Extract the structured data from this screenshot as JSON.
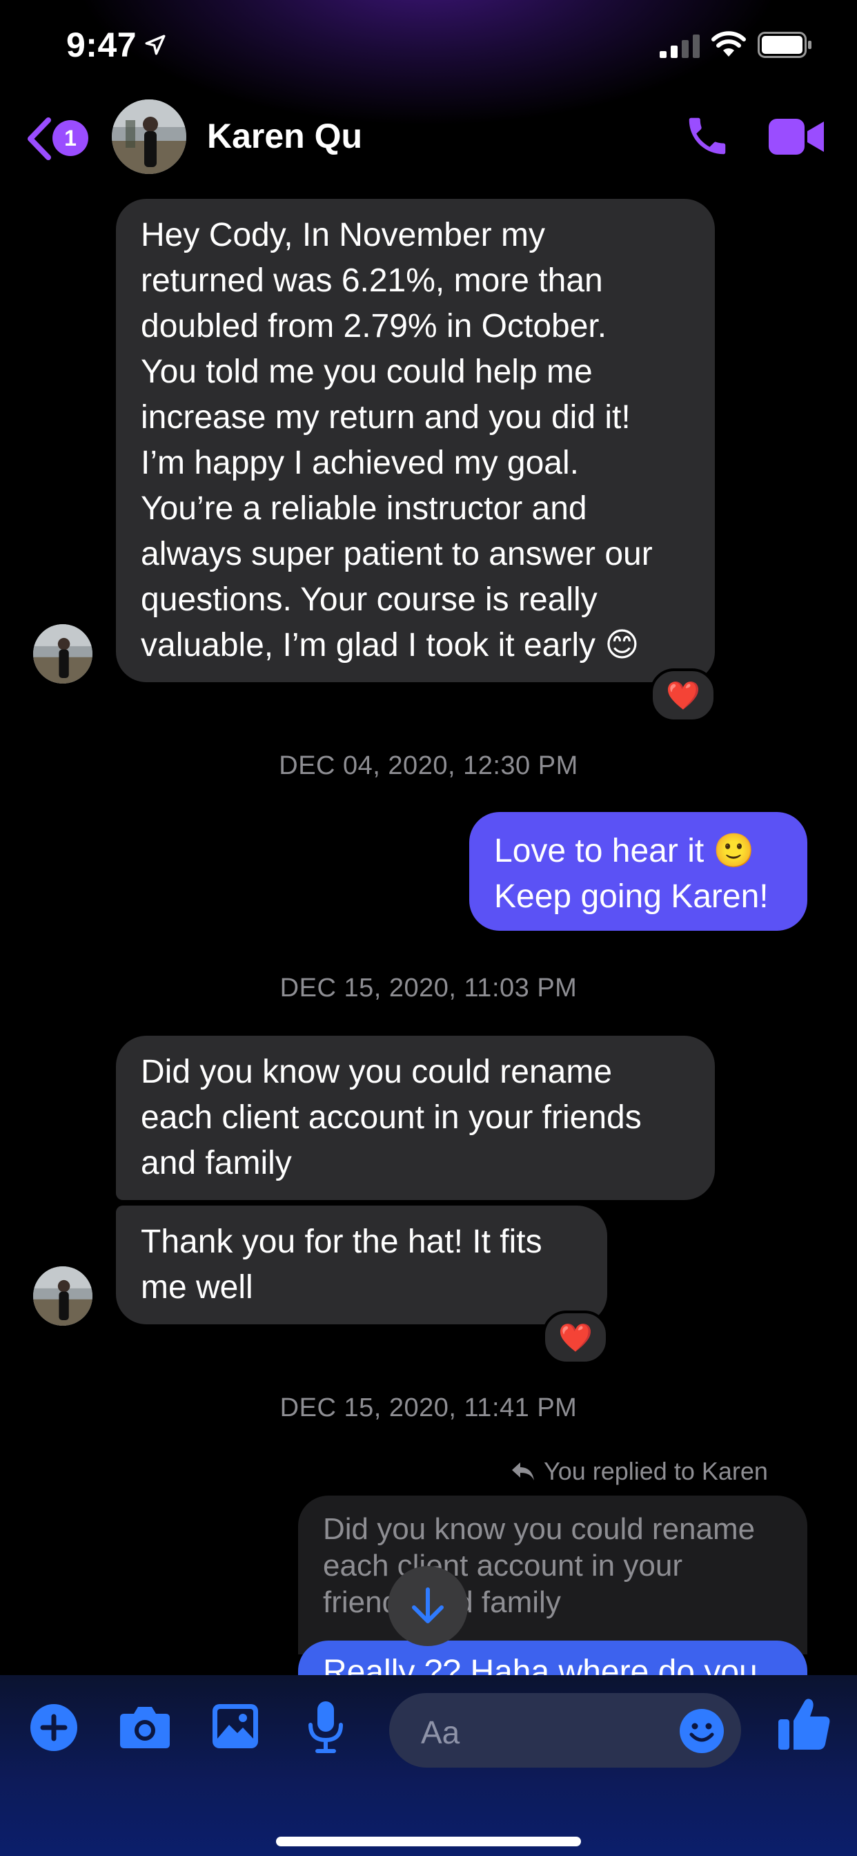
{
  "status_bar": {
    "time": "9:47"
  },
  "header": {
    "back_badge": "1",
    "contact_name": "Karen Qu"
  },
  "messages": {
    "m1": {
      "lines": [
        "Hey Cody, In November my",
        "returned was 6.21%, more than",
        "doubled from 2.79% in October.",
        "You told me you could help me",
        "increase my return and you did it!",
        "I’m happy I achieved my goal.",
        "You’re a reliable instructor and",
        "always super patient to answer our",
        "questions. Your course is really",
        "valuable, I’m glad I took it early 😊"
      ],
      "reaction": "❤️"
    },
    "ts1": "DEC 04, 2020, 12:30 PM",
    "m2": {
      "lines": [
        "Love to hear it 🙂",
        "Keep going Karen!"
      ]
    },
    "ts2": "DEC 15, 2020, 11:03 PM",
    "m3": {
      "lines": [
        "Did you know you could rename",
        "each client account in your friends",
        "and family"
      ]
    },
    "m4": {
      "lines": [
        "Thank you for the hat! It fits",
        "me well"
      ],
      "reaction": "❤️"
    },
    "ts3": "DEC 15, 2020, 11:41 PM",
    "reply_note": "You replied to Karen",
    "quoted": {
      "lines": [
        "Did you know you could rename",
        "each client account in your",
        "friends and family"
      ]
    },
    "m5_partial": "Really ?? Haha where do you"
  },
  "composer": {
    "placeholder": "Aa"
  },
  "colors": {
    "accent_purple": "#9a4dff",
    "outgoing_bubble": "#5b52f5",
    "incoming_bubble": "#2c2c2e",
    "composer_icons": "#2f7bff"
  },
  "icons": {
    "location": "location-arrow-icon",
    "back": "chevron-left-icon",
    "call": "phone-icon",
    "video": "video-camera-icon",
    "add": "plus-circle-icon",
    "camera": "camera-icon",
    "gallery": "image-icon",
    "mic": "microphone-icon",
    "emoji": "smiley-icon",
    "like": "thumbs-up-icon",
    "scroll": "arrow-down-icon",
    "reply": "reply-arrow-icon"
  }
}
